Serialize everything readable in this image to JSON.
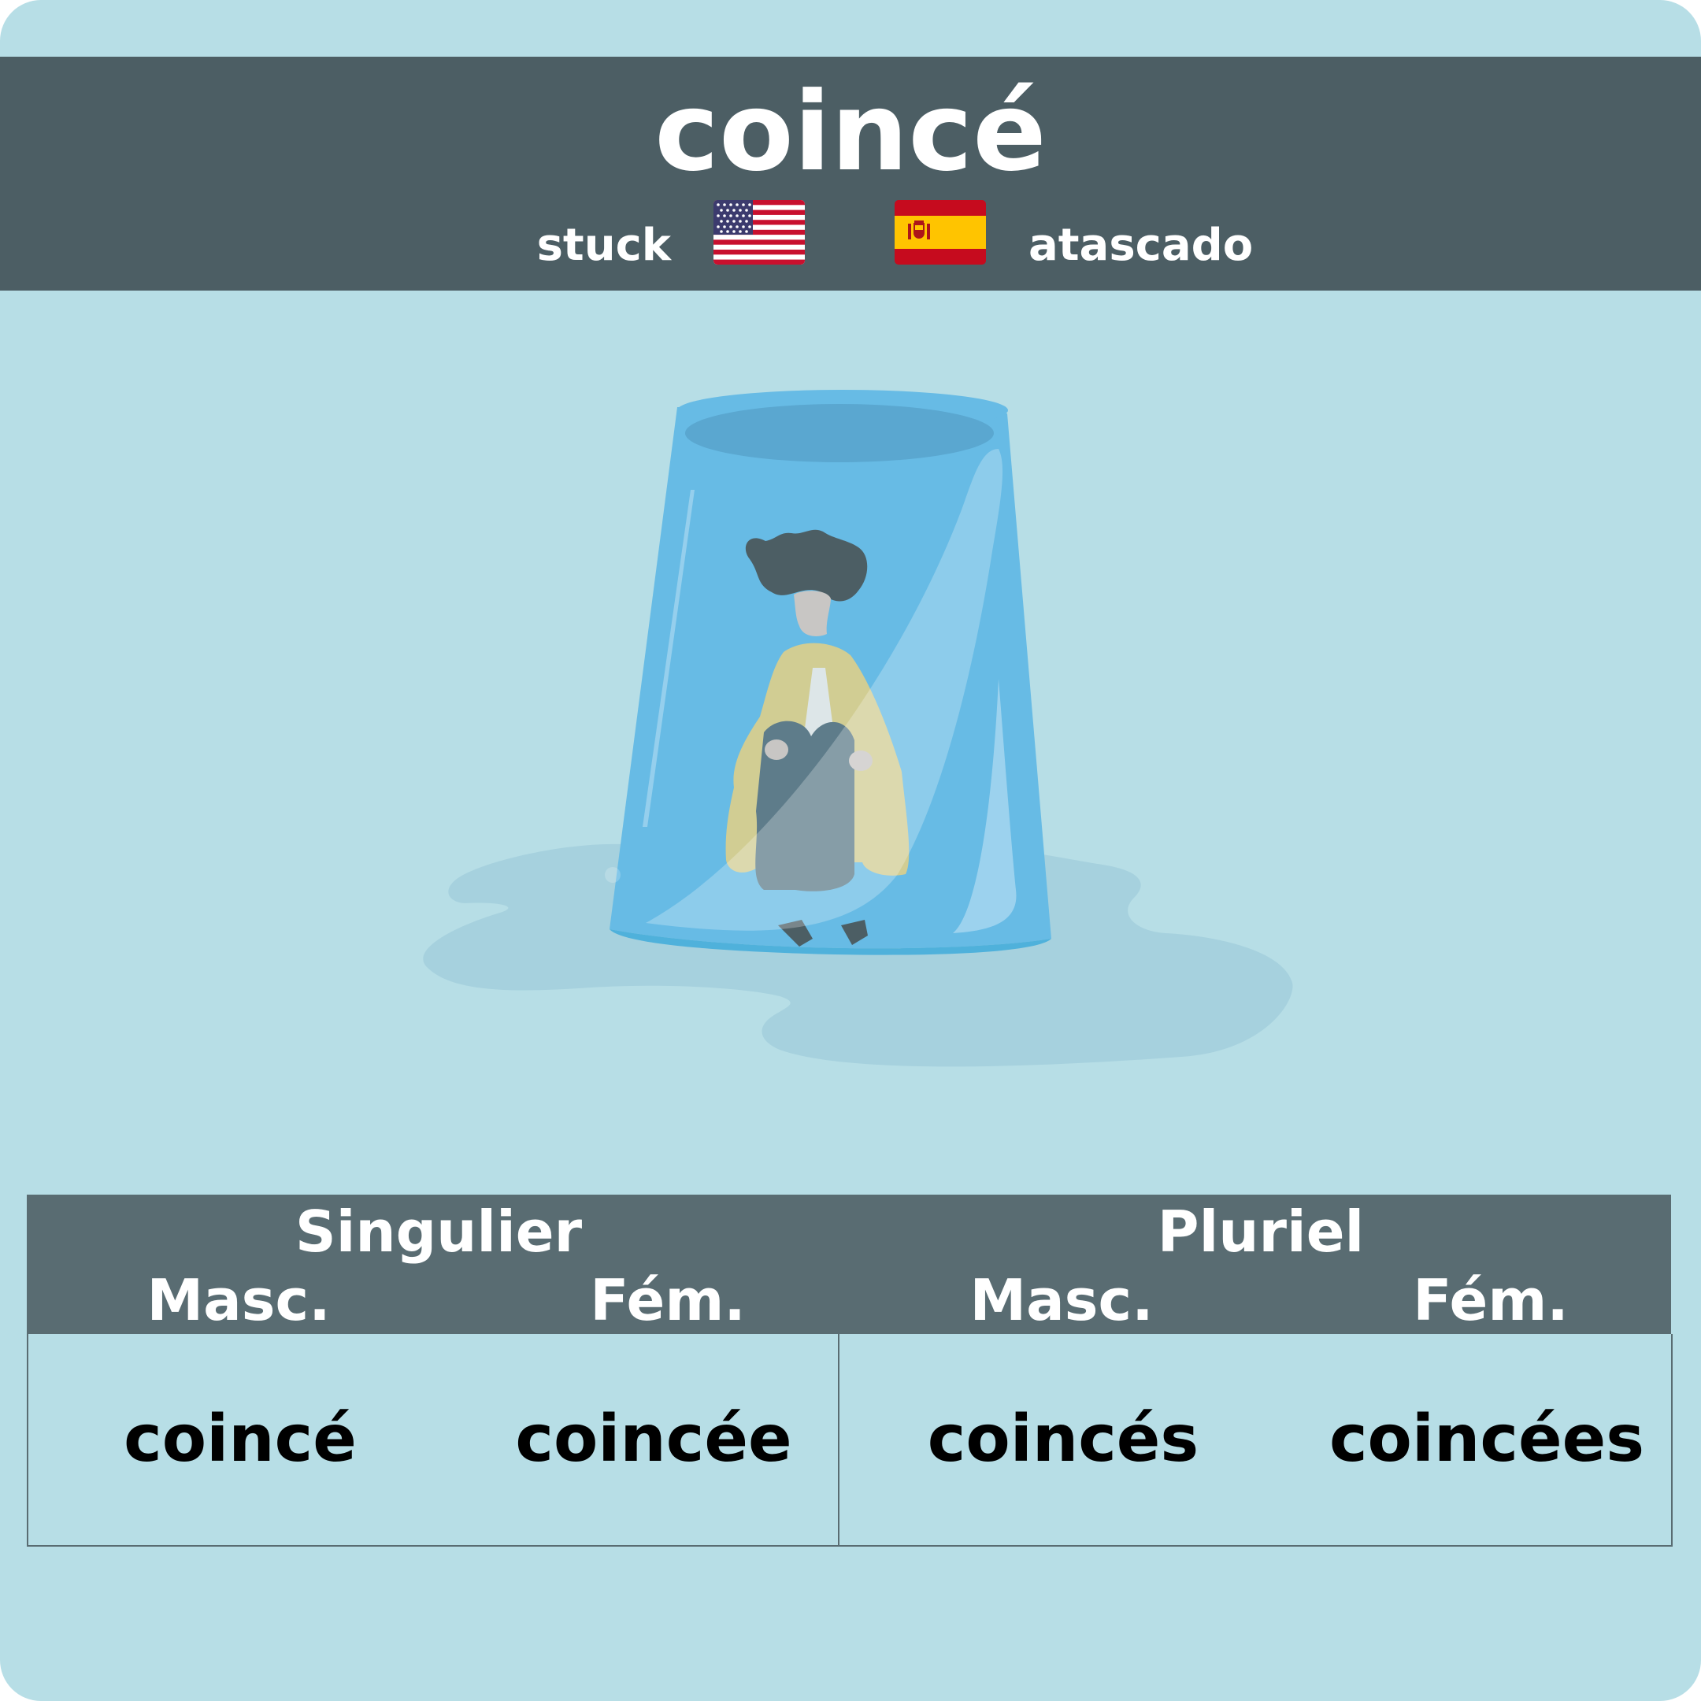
{
  "word": "coincé",
  "translations": {
    "english": "stuck",
    "spanish": "atascado"
  },
  "flags": {
    "english": "us-flag-icon",
    "spanish": "spain-flag-icon"
  },
  "illustration": "person-trapped-in-glass",
  "table": {
    "groups": [
      "Singulier",
      "Pluriel"
    ],
    "subheaders": [
      "Masc.",
      "Fém.",
      "Masc.",
      "Fém."
    ],
    "forms": [
      "coincé",
      "coincée",
      "coincés",
      "coincées"
    ]
  },
  "colors": {
    "background": "#b7dee6",
    "header": "#4c5e64",
    "table_header": "#596c72"
  }
}
